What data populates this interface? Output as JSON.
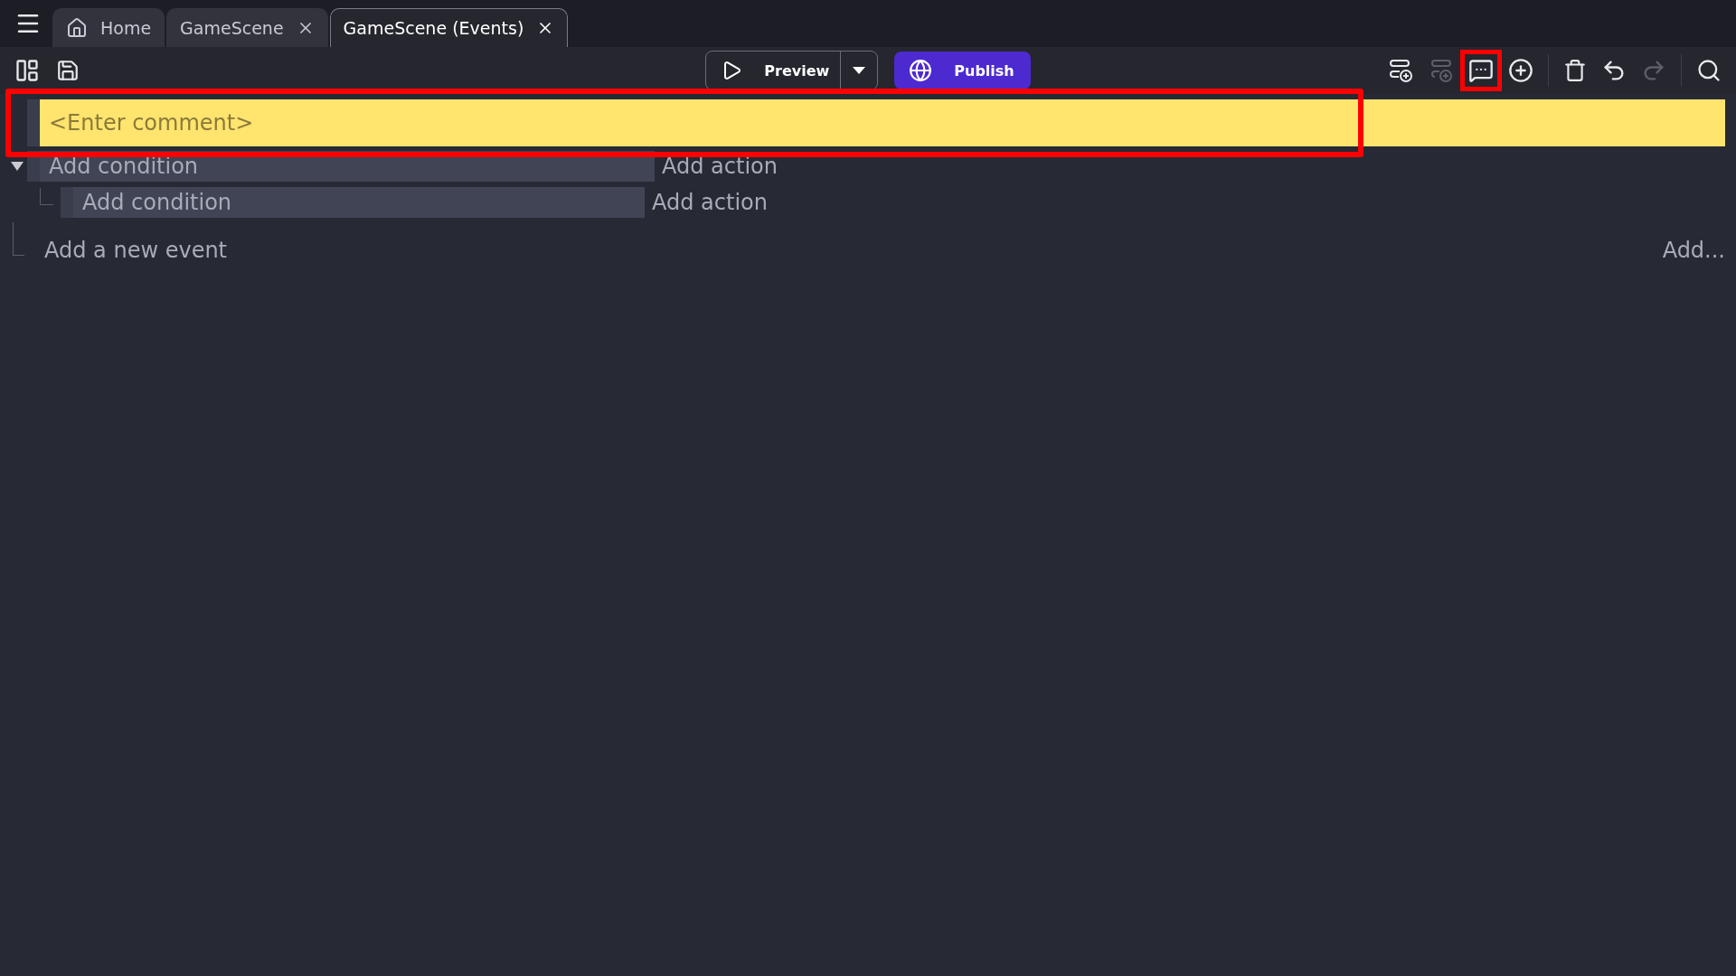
{
  "tabs": [
    {
      "kind": "home",
      "label": "Home",
      "selected": false,
      "closable": false
    },
    {
      "kind": "scene",
      "label": "GameScene",
      "selected": false,
      "closable": true
    },
    {
      "kind": "scene",
      "label": "GameScene (Events)",
      "selected": true,
      "closable": true
    }
  ],
  "toolbar": {
    "preview": {
      "label": "Preview"
    },
    "publish": {
      "label": "Publish"
    },
    "tools": [
      {
        "kind": "add-event",
        "disabled": false,
        "highlighted": false
      },
      {
        "kind": "add-subevent",
        "disabled": true,
        "highlighted": false
      },
      {
        "kind": "add-comment",
        "disabled": false,
        "highlighted": true
      },
      {
        "kind": "add-other",
        "disabled": false,
        "highlighted": false
      },
      {
        "kind": "delete",
        "disabled": false,
        "highlighted": false
      },
      {
        "kind": "undo",
        "disabled": false,
        "highlighted": false
      },
      {
        "kind": "redo",
        "disabled": true,
        "highlighted": false
      },
      {
        "kind": "search",
        "disabled": false,
        "highlighted": false
      }
    ]
  },
  "comment": {
    "placeholder": "<Enter comment>",
    "highlighted": true
  },
  "events": [
    {
      "condition": "Add condition",
      "action": "Add action",
      "expanded": true,
      "children": [
        {
          "condition": "Add condition",
          "action": "Add action"
        }
      ]
    }
  ],
  "footer": {
    "add_event": "Add a new event",
    "add_more": "Add..."
  }
}
